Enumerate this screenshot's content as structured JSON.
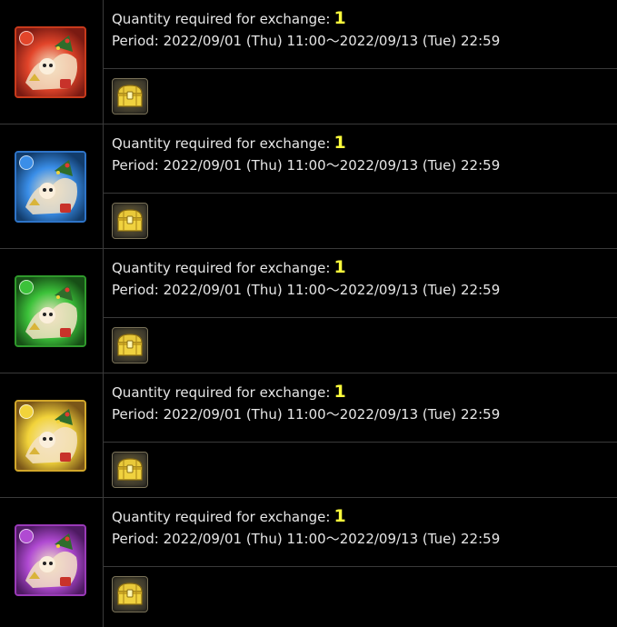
{
  "items": [
    {
      "qty_label": "Quantity required for exchange:",
      "qty_value": "1",
      "period": "Period: 2022/09/01 (Thu) 11:00～2022/09/13 (Tue) 22:59",
      "attribute": "fire",
      "frame_color": "#c83a1c",
      "bg_color": "#7a1a12",
      "orb_color": "#e2452a",
      "icon": "monster-fire-icon",
      "reward_icon": "treasure-chest-icon"
    },
    {
      "qty_label": "Quantity required for exchange:",
      "qty_value": "1",
      "period": "Period: 2022/09/01 (Thu) 11:00～2022/09/13 (Tue) 22:59",
      "attribute": "water",
      "frame_color": "#2e74c8",
      "bg_color": "#123c6b",
      "orb_color": "#3a8ee8",
      "icon": "monster-water-icon",
      "reward_icon": "treasure-chest-icon"
    },
    {
      "qty_label": "Quantity required for exchange:",
      "qty_value": "1",
      "period": "Period: 2022/09/01 (Thu) 11:00～2022/09/13 (Tue) 22:59",
      "attribute": "wood",
      "frame_color": "#2f9a2c",
      "bg_color": "#174f16",
      "orb_color": "#3cc23a",
      "icon": "monster-wood-icon",
      "reward_icon": "treasure-chest-icon"
    },
    {
      "qty_label": "Quantity required for exchange:",
      "qty_value": "1",
      "period": "Period: 2022/09/01 (Thu) 11:00～2022/09/13 (Tue) 22:59",
      "attribute": "light",
      "frame_color": "#d2a72a",
      "bg_color": "#7a5618",
      "orb_color": "#f2d33a",
      "icon": "monster-light-icon",
      "reward_icon": "treasure-chest-icon"
    },
    {
      "qty_label": "Quantity required for exchange:",
      "qty_value": "1",
      "period": "Period: 2022/09/01 (Thu) 11:00～2022/09/13 (Tue) 22:59",
      "attribute": "dark",
      "frame_color": "#9a3ab8",
      "bg_color": "#4e1a62",
      "orb_color": "#b04ad2",
      "icon": "monster-dark-icon",
      "reward_icon": "treasure-chest-icon"
    }
  ]
}
